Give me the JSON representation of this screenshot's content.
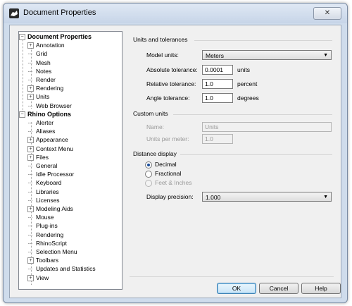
{
  "window": {
    "title": "Document Properties",
    "close_label": "✕"
  },
  "tree": {
    "doc_root": "Document Properties",
    "doc_children": [
      {
        "label": "Annotation",
        "expandable": true
      },
      {
        "label": "Grid",
        "expandable": false
      },
      {
        "label": "Mesh",
        "expandable": false
      },
      {
        "label": "Notes",
        "expandable": false
      },
      {
        "label": "Render",
        "expandable": false
      },
      {
        "label": "Rendering",
        "expandable": true
      },
      {
        "label": "Units",
        "expandable": true
      },
      {
        "label": "Web Browser",
        "expandable": false
      }
    ],
    "rhino_root": "Rhino Options",
    "rhino_children": [
      {
        "label": "Alerter",
        "expandable": false
      },
      {
        "label": "Aliases",
        "expandable": false
      },
      {
        "label": "Appearance",
        "expandable": true
      },
      {
        "label": "Context Menu",
        "expandable": true
      },
      {
        "label": "Files",
        "expandable": true
      },
      {
        "label": "General",
        "expandable": false
      },
      {
        "label": "Idle Processor",
        "expandable": false
      },
      {
        "label": "Keyboard",
        "expandable": false
      },
      {
        "label": "Libraries",
        "expandable": false
      },
      {
        "label": "Licenses",
        "expandable": false
      },
      {
        "label": "Modeling Aids",
        "expandable": true
      },
      {
        "label": "Mouse",
        "expandable": false
      },
      {
        "label": "Plug-ins",
        "expandable": false
      },
      {
        "label": "Rendering",
        "expandable": false
      },
      {
        "label": "RhinoScript",
        "expandable": false
      },
      {
        "label": "Selection Menu",
        "expandable": false
      },
      {
        "label": "Toolbars",
        "expandable": true
      },
      {
        "label": "Updates and Statistics",
        "expandable": false
      },
      {
        "label": "View",
        "expandable": true
      }
    ]
  },
  "units": {
    "group_title": "Units and tolerances",
    "model_units_label": "Model units:",
    "model_units_value": "Meters",
    "abs_tol_label": "Absolute tolerance:",
    "abs_tol_value": "0.0001",
    "abs_tol_unit": "units",
    "rel_tol_label": "Relative tolerance:",
    "rel_tol_value": "1.0",
    "rel_tol_unit": "percent",
    "ang_tol_label": "Angle tolerance:",
    "ang_tol_value": "1.0",
    "ang_tol_unit": "degrees"
  },
  "custom": {
    "group_title": "Custom units",
    "name_label": "Name:",
    "name_value": "Units",
    "upm_label": "Units per meter:",
    "upm_value": "1.0"
  },
  "distance": {
    "group_title": "Distance display",
    "options": [
      "Decimal",
      "Fractional",
      "Feet & Inches"
    ],
    "selected": "Decimal",
    "precision_label": "Display precision:",
    "precision_value": "1.000"
  },
  "buttons": {
    "ok": "OK",
    "cancel": "Cancel",
    "help": "Help"
  },
  "icons": {
    "dropdown": "▼",
    "expand": "+",
    "collapse": "−"
  }
}
